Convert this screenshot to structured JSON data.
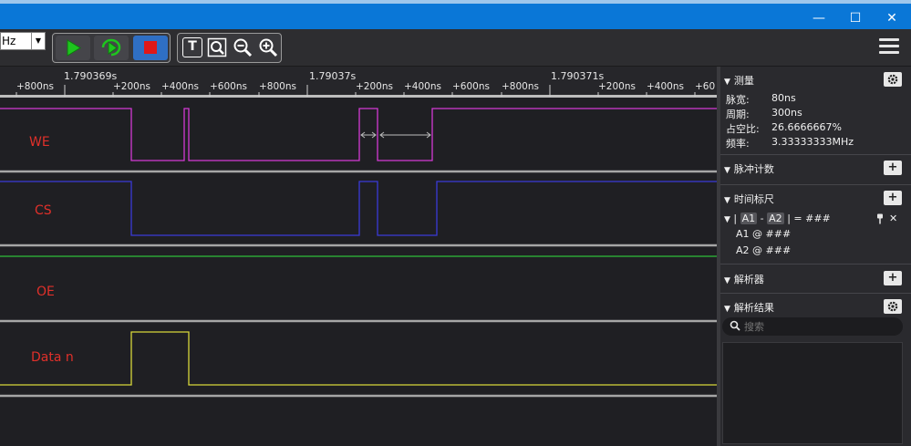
{
  "window": {
    "minimize_glyph": "—",
    "maximize_glyph": "☐",
    "close_glyph": "✕"
  },
  "toolbar": {
    "frequency_value": "Hz",
    "dropdown_glyph": "▼",
    "start_icon": "play-icon",
    "repeat_icon": "repeat-icon",
    "stop_icon": "stop-icon",
    "text_tool_glyph": "T",
    "zoom_fit_icon": "zoom-fit-icon",
    "zoom_out_icon": "zoom-out-icon",
    "zoom_in_icon": "zoom-in-icon",
    "menu_icon": "hamburger-icon"
  },
  "timeline": {
    "major_labels": [
      "1.790369s",
      "1.79037s",
      "1.790371s"
    ],
    "minor_labels": [
      "+800ns",
      "+200ns",
      "+400ns",
      "+600ns",
      "+800ns",
      "+200ns",
      "+400ns",
      "+600ns",
      "+800ns",
      "+200ns",
      "+400ns",
      "+60"
    ]
  },
  "channels": [
    {
      "name": "WE",
      "color": "#d43ad4"
    },
    {
      "name": "CS",
      "color": "#3a3ad8"
    },
    {
      "name": "OE",
      "color": "#2fbf3a"
    },
    {
      "name": "Data n",
      "color": "#d8d83a"
    }
  ],
  "colors": {
    "accent": "#0a77d7",
    "label_red": "#e0302a",
    "start_green": "#1ec51e",
    "stop_red": "#e01818",
    "stop_bg": "#2f6fc4"
  },
  "panel": {
    "measure": {
      "title": "测量",
      "settings_icon": "gear-icon",
      "rows": [
        {
          "label": "脉宽:",
          "value": "80ns"
        },
        {
          "label": "周期:",
          "value": "300ns"
        },
        {
          "label": "占空比:",
          "value": "26.6666667%"
        },
        {
          "label": "频率:",
          "value": "3.33333333MHz"
        }
      ]
    },
    "pulse_count": {
      "title": "脉冲计数",
      "add_glyph": "+"
    },
    "time_ruler": {
      "title": "时间标尺",
      "add_glyph": "+",
      "pipe_open": "|",
      "a1": "A1",
      "dash": "-",
      "a2": "A2",
      "equals": "| = ###",
      "line2": "A1 @ ###",
      "line3": "A2 @ ###",
      "pin_icon": "pin-icon",
      "close_glyph": "✕"
    },
    "analyzer": {
      "title": "解析器",
      "add_glyph": "+"
    },
    "results": {
      "title": "解析结果",
      "settings_icon": "gear-icon",
      "search_placeholder": "搜索"
    }
  }
}
